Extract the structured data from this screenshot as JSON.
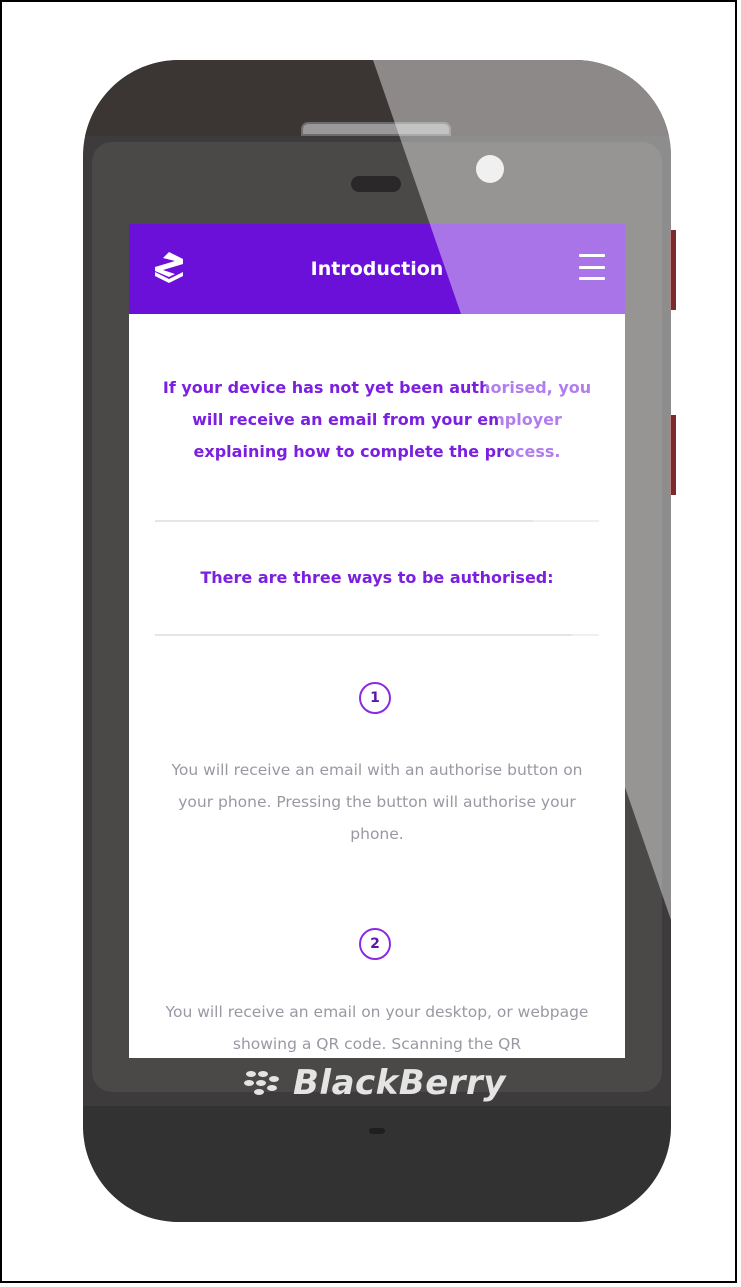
{
  "header": {
    "title": "Introduction",
    "logo_icon": "shield-s-logo-icon",
    "menu_icon": "hamburger-menu-icon",
    "color": "#6a10d8"
  },
  "content": {
    "intro": "If your device has not yet been authorised, you will receive an email from your employer explaining how to complete the process.",
    "ways_heading": "There are three ways to be authorised:",
    "steps": [
      {
        "number": "1",
        "text": "You will receive an email with an authorise button on your phone. Pressing the button will authorise your phone."
      },
      {
        "number": "2",
        "text": "You will receive an email on your desktop, or webpage showing a QR code. Scanning the QR"
      }
    ],
    "accent_color": "#7b1fe0"
  },
  "device": {
    "brand": "BlackBerry",
    "brand_logo_icon": "blackberry-logo-icon"
  }
}
